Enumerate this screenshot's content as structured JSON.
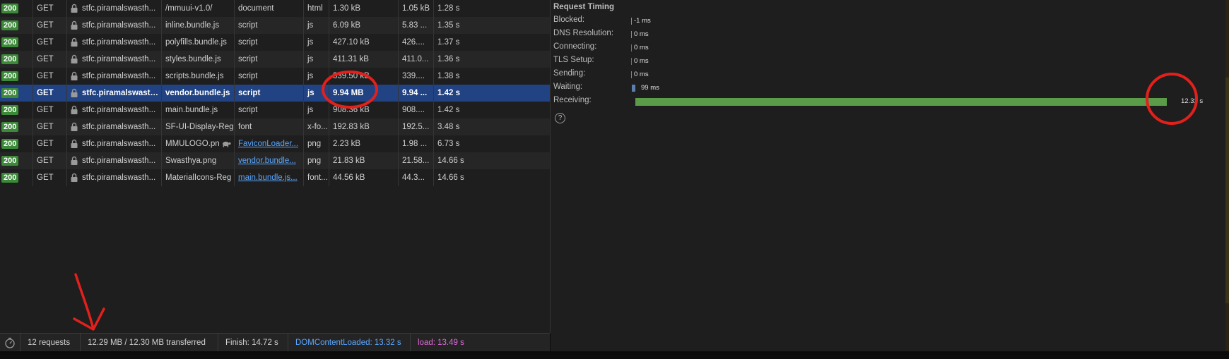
{
  "requests": [
    {
      "status": "200",
      "method": "GET",
      "domain": "stfc.piramalswasth...",
      "name": "/mmuui-v1.0/",
      "initiator": "document",
      "type": "html",
      "size": "1.30 kB",
      "transferred": "1.05 kB",
      "time": "1.28 s"
    },
    {
      "status": "200",
      "method": "GET",
      "domain": "stfc.piramalswasth...",
      "name": "inline.bundle.js",
      "initiator": "script",
      "type": "js",
      "size": "6.09 kB",
      "transferred": "5.83 ...",
      "time": "1.35 s"
    },
    {
      "status": "200",
      "method": "GET",
      "domain": "stfc.piramalswasth...",
      "name": "polyfills.bundle.js",
      "initiator": "script",
      "type": "js",
      "size": "427.10 kB",
      "transferred": "426....",
      "time": "1.37 s"
    },
    {
      "status": "200",
      "method": "GET",
      "domain": "stfc.piramalswasth...",
      "name": "styles.bundle.js",
      "initiator": "script",
      "type": "js",
      "size": "411.31 kB",
      "transferred": "411.0...",
      "time": "1.36 s"
    },
    {
      "status": "200",
      "method": "GET",
      "domain": "stfc.piramalswasth...",
      "name": "scripts.bundle.js",
      "initiator": "script",
      "type": "js",
      "size": "339.50 kB",
      "transferred": "339....",
      "time": "1.38 s"
    },
    {
      "status": "200",
      "method": "GET",
      "domain": "stfc.piramalswasth...",
      "name": "vendor.bundle.js",
      "initiator": "script",
      "type": "js",
      "size": "9.94 MB",
      "transferred": "9.94 ...",
      "time": "1.42 s",
      "selected": true
    },
    {
      "status": "200",
      "method": "GET",
      "domain": "stfc.piramalswasth...",
      "name": "main.bundle.js",
      "initiator": "script",
      "type": "js",
      "size": "908.36 kB",
      "transferred": "908....",
      "time": "1.42 s"
    },
    {
      "status": "200",
      "method": "GET",
      "domain": "stfc.piramalswasth...",
      "name": "SF-UI-Display-Reg",
      "initiator": "font",
      "type": "x-fo...",
      "size": "192.83 kB",
      "transferred": "192.5...",
      "time": "3.48 s"
    },
    {
      "status": "200",
      "method": "GET",
      "domain": "stfc.piramalswasth...",
      "name": "MMULOGO.pn",
      "initiator": "FaviconLoader...",
      "initiator_link": true,
      "slow": true,
      "type": "png",
      "size": "2.23 kB",
      "transferred": "1.98 ...",
      "time": "6.73 s"
    },
    {
      "status": "200",
      "method": "GET",
      "domain": "stfc.piramalswasth...",
      "name": "Swasthya.png",
      "initiator": "vendor.bundle...",
      "initiator_link": true,
      "type": "png",
      "size": "21.83 kB",
      "transferred": "21.58...",
      "time": "14.66 s"
    },
    {
      "status": "200",
      "method": "GET",
      "domain": "stfc.piramalswasth...",
      "name": "MaterialIcons-Reg",
      "initiator": "main.bundle.js...",
      "initiator_link": true,
      "type": "font...",
      "size": "44.56 kB",
      "transferred": "44.3...",
      "time": "14.66 s"
    }
  ],
  "status_bar": {
    "requests": "12 requests",
    "transferred": "12.29 MB / 12.30 MB transferred",
    "finish": "Finish: 14.72 s",
    "dom_content_loaded": "DOMContentLoaded: 13.32 s",
    "load": "load: 13.49 s"
  },
  "timing": {
    "title": "Request Timing",
    "rows": [
      {
        "label": "Blocked:",
        "value": "-1 ms",
        "color": "#d45dd0"
      },
      {
        "label": "DNS Resolution:",
        "value": "0 ms",
        "color": "#c97a3a"
      },
      {
        "label": "Connecting:",
        "value": "0 ms",
        "color": "#c94d4d"
      },
      {
        "label": "TLS Setup:",
        "value": "0 ms",
        "color": "#c94d4d"
      },
      {
        "label": "Sending:",
        "value": "0 ms",
        "color": "#4d8fc9"
      },
      {
        "label": "Waiting:",
        "value": "99 ms",
        "color": "#5a7fae"
      },
      {
        "label": "Receiving:",
        "value": "12.32 s",
        "color": "#5b9c49"
      }
    ],
    "help": "?"
  },
  "colors": {
    "selected_row": "#214283",
    "status_badge": "#3c8a39",
    "link": "#5aa7ff",
    "dom_content_loaded": "#5aa7ff",
    "load": "#e16bd8",
    "annotation": "#e3201b"
  },
  "icons": [
    "lock-icon",
    "turtle-icon",
    "stopwatch-icon",
    "help-icon"
  ]
}
